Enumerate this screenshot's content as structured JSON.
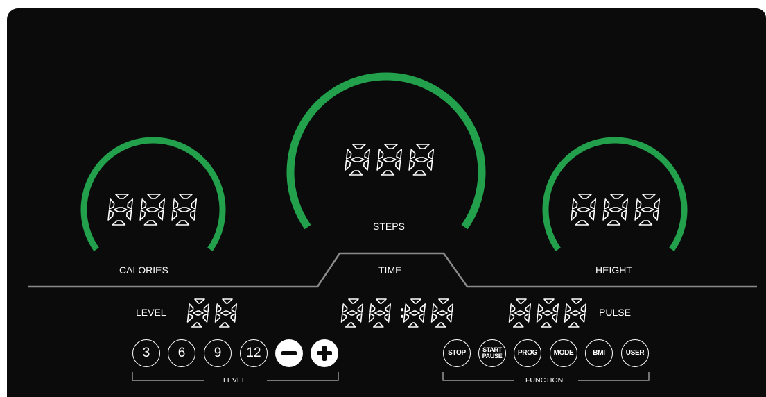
{
  "gauges": {
    "calories": {
      "label": "CALORIES",
      "display": "888"
    },
    "steps": {
      "label": "STEPS",
      "display": "888"
    },
    "height": {
      "label": "HEIGHT",
      "display": "888"
    }
  },
  "time": {
    "label": "TIME",
    "display": "88:88"
  },
  "level": {
    "label": "LEVEL",
    "display": "88"
  },
  "pulse": {
    "label": "PULSE",
    "display": "888"
  },
  "level_buttons": {
    "group_label": "LEVEL",
    "presets": [
      "3",
      "6",
      "9",
      "12"
    ],
    "minus_icon": "minus-icon",
    "plus_icon": "plus-icon"
  },
  "function_buttons": {
    "group_label": "FUNCTION",
    "stop": "STOP",
    "start_line1": "START",
    "start_line2": "PAUSE",
    "prog": "PROG",
    "mode": "MODE",
    "bmi": "BMI",
    "user": "USER"
  },
  "colors": {
    "arc": "#22a04b",
    "panel": "#0b0b0b",
    "text": "#ffffff",
    "divider": "#8a8a8a"
  }
}
